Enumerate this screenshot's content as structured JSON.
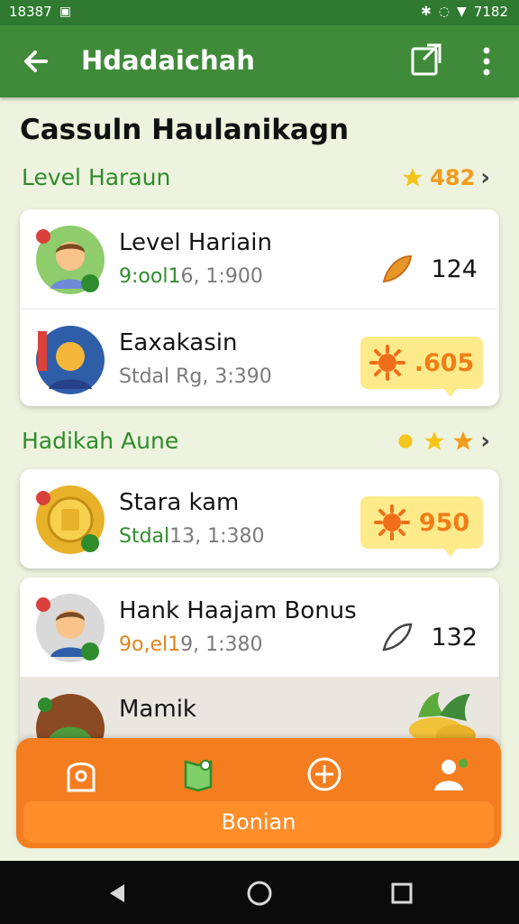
{
  "status_bar": {
    "time": "18387",
    "right_text": "7182"
  },
  "app_bar": {
    "title": "Hdadaichah"
  },
  "page": {
    "heading": "Cassuln Haulanikagn"
  },
  "section1": {
    "label": "Level Haraun",
    "reward_value": "482"
  },
  "section2": {
    "label": "Hadikah Aune"
  },
  "list1": [
    {
      "name": "Level Hariain",
      "sub_prefix": "9:ool1",
      "sub_suffix": "6, 1:900",
      "value": "124"
    },
    {
      "name": "Eaxakasin",
      "sub_prefix": "",
      "sub_suffix": "Stdal Rg, 3:390",
      "value": ".605"
    }
  ],
  "list2": [
    {
      "name": "Stara kam",
      "sub_prefix": "Stdal",
      "sub_suffix": "13, 1:380",
      "value": "950"
    },
    {
      "name": "Hank Haajam Bonus",
      "sub_prefix": "9o,el1",
      "sub_suffix": "9, 1:380",
      "value": "132"
    },
    {
      "name": "Mamik",
      "sub_prefix": "",
      "sub_suffix": "",
      "value": ""
    }
  ],
  "bottom": {
    "button_label": "Bonian"
  },
  "colors": {
    "primary_green": "#3f8b3a",
    "accent_orange": "#f47e1f",
    "reward_yellow": "#fdea8a"
  },
  "icons": [
    "back-arrow-icon",
    "share-icon",
    "more-vert-icon",
    "star-icon",
    "leaf-icon",
    "sun-icon",
    "home-icon",
    "map-icon",
    "add-icon",
    "profile-icon"
  ]
}
